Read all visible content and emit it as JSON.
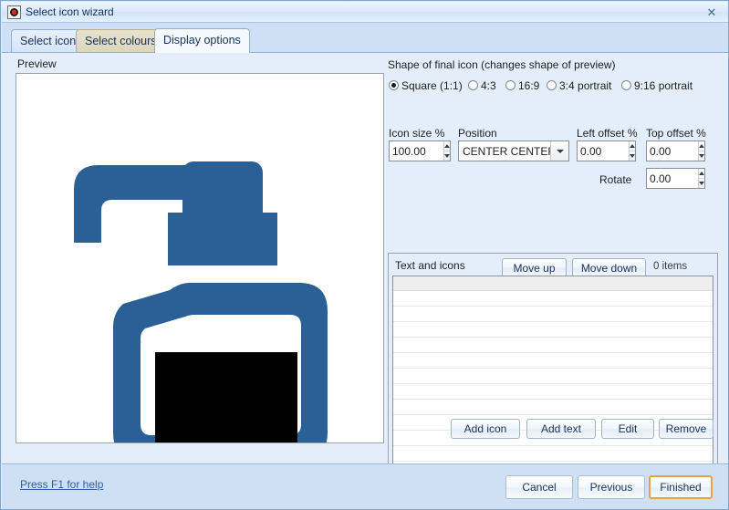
{
  "window": {
    "title": "Select icon wizard",
    "app_icon": "target-icon",
    "close_label": "✕"
  },
  "tabs": [
    {
      "label": "Select icon",
      "state": "normal"
    },
    {
      "label": "Select colours",
      "state": "hovered"
    },
    {
      "label": "Display options",
      "state": "active"
    }
  ],
  "preview": {
    "label": "Preview",
    "icon_name": "soap-dispenser-icon",
    "icon_color": "#2b6096",
    "overlay_color": "#000000",
    "background": "#ffffff"
  },
  "shape": {
    "caption": "Shape of final icon (changes shape of preview)",
    "options": [
      {
        "label": "Square (1:1)",
        "checked": true
      },
      {
        "label": "4:3",
        "checked": false
      },
      {
        "label": "16:9",
        "checked": false
      },
      {
        "label": "3:4 portrait",
        "checked": false
      },
      {
        "label": "9:16 portrait",
        "checked": false
      }
    ]
  },
  "fields": {
    "icon_size": {
      "label": "Icon size %",
      "value": "100.00"
    },
    "position": {
      "label": "Position",
      "value": "CENTER CENTER"
    },
    "left_offset": {
      "label": "Left offset %",
      "value": "0.00"
    },
    "top_offset": {
      "label": "Top offset %",
      "value": "0.00"
    },
    "rotate": {
      "label": "Rotate",
      "value": "0.00"
    }
  },
  "text_and_icons": {
    "caption": "Text and icons",
    "move_up": "Move up",
    "move_down": "Move down",
    "items_count": "0 items",
    "rows": [],
    "actions": {
      "add_icon": "Add icon",
      "add_text": "Add text",
      "edit": "Edit",
      "remove": "Remove"
    }
  },
  "footer": {
    "help": "Press F1 for help",
    "cancel": "Cancel",
    "previous": "Previous",
    "finished": "Finished"
  }
}
